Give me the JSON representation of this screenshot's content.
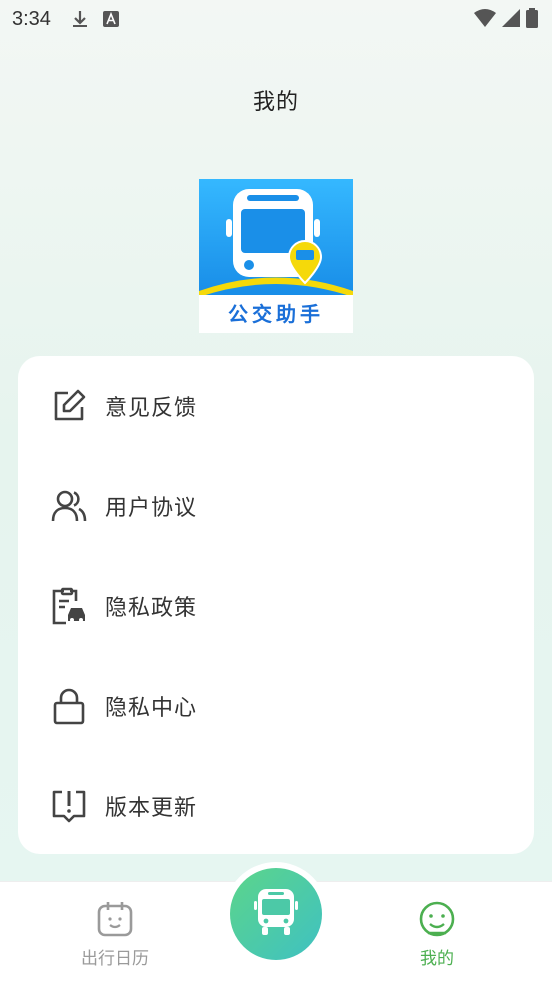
{
  "status_bar": {
    "time": "3:34",
    "icons": [
      "download-icon",
      "a-text-icon",
      "wifi-icon",
      "signal-icon",
      "battery-icon"
    ]
  },
  "header": {
    "title": "我的"
  },
  "logo": {
    "text": "公交助手",
    "colors": {
      "primary": "#1a8fe8",
      "accent": "#f5d90a"
    }
  },
  "menu": {
    "items": [
      {
        "label": "意见反馈",
        "icon": "edit-icon"
      },
      {
        "label": "用户协议",
        "icon": "users-icon"
      },
      {
        "label": "隐私政策",
        "icon": "clipboard-car-icon"
      },
      {
        "label": "隐私中心",
        "icon": "lock-icon"
      },
      {
        "label": "版本更新",
        "icon": "update-alert-icon"
      }
    ]
  },
  "bottom_nav": {
    "items": [
      {
        "label": "出行日历",
        "icon": "calendar-icon",
        "active": false
      },
      {
        "label": "",
        "icon": "bus-icon",
        "active": false
      },
      {
        "label": "我的",
        "icon": "smile-icon",
        "active": true
      }
    ],
    "colors": {
      "active": "#4caf50",
      "inactive": "#9a9a9a"
    }
  }
}
